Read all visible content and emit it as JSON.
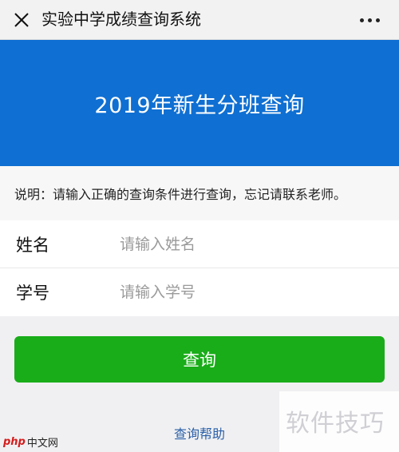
{
  "header": {
    "title": "实验中学成绩查询系统",
    "close_icon": "close-icon",
    "more_icon": "more-icon"
  },
  "banner": {
    "title": "2019年新生分班查询",
    "color": "#0f6fd2"
  },
  "notice": {
    "text": "说明：请输入正确的查询条件进行查询，忘记请联系老师。"
  },
  "form": {
    "fields": [
      {
        "label": "姓名",
        "placeholder": "请输入姓名",
        "value": ""
      },
      {
        "label": "学号",
        "placeholder": "请输入学号",
        "value": ""
      }
    ]
  },
  "actions": {
    "query_label": "查询",
    "query_color": "#19ad19",
    "help_label": "查询帮助"
  },
  "watermark": {
    "text": "软件技巧",
    "logo_php": "php",
    "logo_cn": "中文网"
  }
}
